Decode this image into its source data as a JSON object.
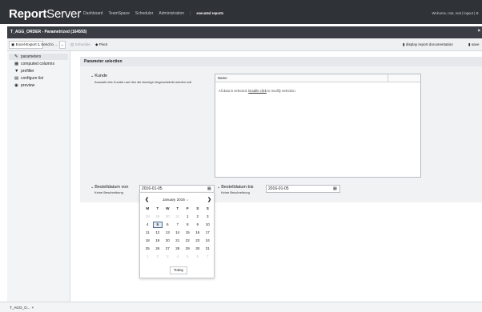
{
  "brand": {
    "bold": "Report",
    "light": "Server"
  },
  "nav": {
    "items": [
      "Dashboard",
      "TeamSpace",
      "Scheduler",
      "Administration"
    ],
    "separator": "|",
    "current": "executed reports"
  },
  "welcome": "Welcome, root, root | logout | ⚙",
  "window": {
    "title": "T_AGG_ORDER - Parametrized (164593)",
    "close": "×"
  },
  "toolbar": {
    "excel_export": "Excel-Export",
    "send_to": "Send to ...",
    "schedule": "Schedule",
    "pivot": "Pivot",
    "display_doc": "display report documentation",
    "save": "save"
  },
  "sidebar": {
    "items": [
      {
        "icon": "edit-icon",
        "glyph": "✎",
        "label": "parameters"
      },
      {
        "icon": "calculator-icon",
        "glyph": "▦",
        "label": "computed columns"
      },
      {
        "icon": "filter-icon",
        "glyph": "▼",
        "label": "prefilter"
      },
      {
        "icon": "table-icon",
        "glyph": "▤",
        "label": "configure list"
      },
      {
        "icon": "eye-icon",
        "glyph": "◉",
        "label": "preview"
      }
    ]
  },
  "params": {
    "header": "Parameter selection",
    "kunde": {
      "label": "Kunde",
      "description": "Auswahl des Kunden auf den die Anzeige eingeschränkt werden soll",
      "list_column": "Name",
      "note_prefix": "All data is selected. ",
      "note_link": "Double click",
      "note_suffix": " to modify selection."
    },
    "date_from": {
      "label": "Bestelldatum von",
      "description": "Keine Beschreibung",
      "value": "2016-01-05"
    },
    "date_to": {
      "label": "Bestelldatum bis",
      "description": "Keine Beschreibung",
      "value": "2016-01-05"
    }
  },
  "datepicker": {
    "month": "January 2016 ⌵",
    "prev": "❮",
    "next": "❯",
    "weekdays": [
      "M",
      "T",
      "W",
      "T",
      "F",
      "S",
      "S"
    ],
    "weeks": [
      [
        "28",
        "29",
        "30",
        "31",
        "1",
        "2",
        "3"
      ],
      [
        "4",
        "5",
        "6",
        "7",
        "8",
        "9",
        "10"
      ],
      [
        "11",
        "12",
        "13",
        "14",
        "15",
        "16",
        "17"
      ],
      [
        "18",
        "19",
        "20",
        "21",
        "22",
        "23",
        "24"
      ],
      [
        "25",
        "26",
        "27",
        "28",
        "29",
        "30",
        "31"
      ],
      [
        "1",
        "2",
        "3",
        "4",
        "5",
        "6",
        "7"
      ]
    ],
    "muted": [
      [
        0,
        0
      ],
      [
        0,
        1
      ],
      [
        0,
        2
      ],
      [
        0,
        3
      ],
      [
        5,
        0
      ],
      [
        5,
        1
      ],
      [
        5,
        2
      ],
      [
        5,
        3
      ],
      [
        5,
        4
      ],
      [
        5,
        5
      ],
      [
        5,
        6
      ]
    ],
    "selected": [
      1,
      1
    ],
    "today": "Today"
  },
  "bottom_tab": {
    "label": "T_AGG_O...",
    "close": "×"
  },
  "colors": {
    "topbar": "#2f3237",
    "window_bar": "#3a3e44",
    "panel": "#f1f2f4",
    "accent": "#4a6b8c"
  }
}
